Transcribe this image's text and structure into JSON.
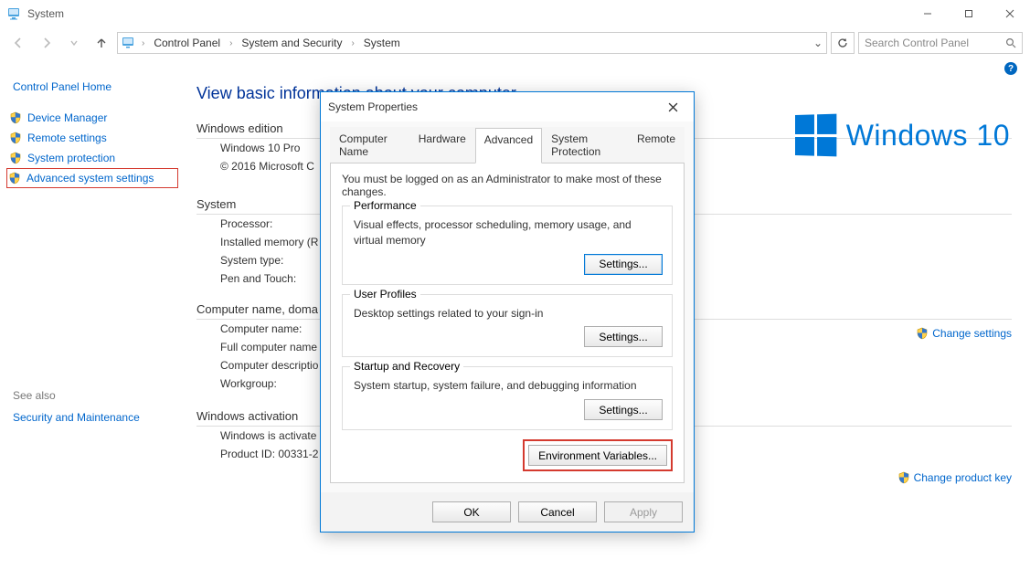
{
  "window": {
    "title": "System",
    "search_placeholder": "Search Control Panel"
  },
  "breadcrumb": {
    "item0": "Control Panel",
    "item1": "System and Security",
    "item2": "System"
  },
  "sidebar": {
    "home": "Control Panel Home",
    "items": [
      {
        "label": "Device Manager"
      },
      {
        "label": "Remote settings"
      },
      {
        "label": "System protection"
      },
      {
        "label": "Advanced system settings"
      }
    ],
    "see_also_heading": "See also",
    "see_also_link": "Security and Maintenance"
  },
  "main": {
    "heading": "View basic information about your computer",
    "windows_edition": {
      "title": "Windows edition",
      "line1": "Windows 10 Pro",
      "line2": "© 2016 Microsoft C"
    },
    "brand": "Windows 10",
    "system": {
      "title": "System",
      "rows": [
        {
          "k": "Processor:"
        },
        {
          "k": "Installed memory (R"
        },
        {
          "k": "System type:"
        },
        {
          "k": "Pen and Touch:"
        }
      ]
    },
    "cndw": {
      "title": "Computer name, doma",
      "rows": [
        {
          "k": "Computer name:"
        },
        {
          "k": "Full computer name"
        },
        {
          "k": "Computer descriptio"
        },
        {
          "k": "Workgroup:"
        }
      ],
      "action": "Change settings"
    },
    "activation": {
      "title": "Windows activation",
      "line1": "Windows is activate",
      "line2_k": "Product ID: 00331-2",
      "action": "Change product key"
    }
  },
  "dialog": {
    "title": "System Properties",
    "tabs": {
      "t0": "Computer Name",
      "t1": "Hardware",
      "t2": "Advanced",
      "t3": "System Protection",
      "t4": "Remote"
    },
    "admin_note": "You must be logged on as an Administrator to make most of these changes.",
    "perf": {
      "legend": "Performance",
      "desc": "Visual effects, processor scheduling, memory usage, and virtual memory",
      "btn": "Settings..."
    },
    "profiles": {
      "legend": "User Profiles",
      "desc": "Desktop settings related to your sign-in",
      "btn": "Settings..."
    },
    "startup": {
      "legend": "Startup and Recovery",
      "desc": "System startup, system failure, and debugging information",
      "btn": "Settings..."
    },
    "env_btn": "Environment Variables...",
    "ok": "OK",
    "cancel": "Cancel",
    "apply": "Apply"
  }
}
